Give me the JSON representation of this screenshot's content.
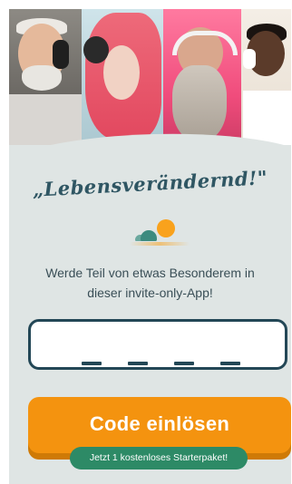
{
  "hero": {
    "description_icons": [
      "person-icon",
      "person-icon",
      "person-icon",
      "person-icon"
    ]
  },
  "headline": "„Lebensverändernd!\"",
  "logo": {
    "icon": "sun-cloud-icon",
    "sun_color": "#f9a21c",
    "cloud_color": "#3d8b7f"
  },
  "subtitle": "Werde Teil von etwas Besonderem in dieser invite-only-App!",
  "code_input": {
    "slots": 4
  },
  "redeem_button": {
    "label": "Code einlösen",
    "color": "#f4930f"
  },
  "badge": {
    "label": "Jetzt 1 kostenloses Starterpaket!",
    "color": "#2d8a66"
  }
}
